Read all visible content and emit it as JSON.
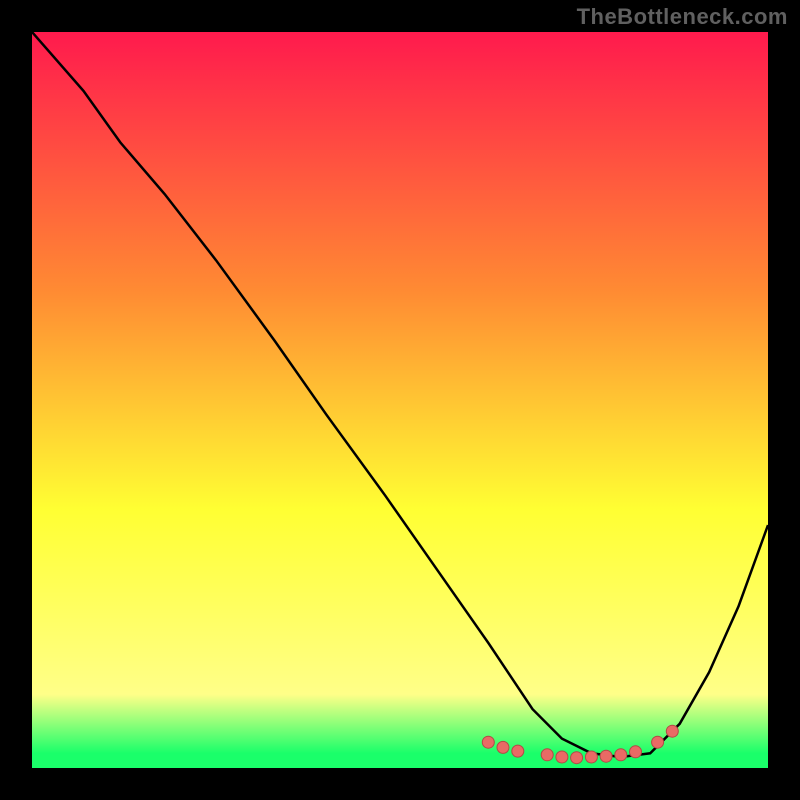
{
  "attribution": "TheBottleneck.com",
  "colors": {
    "gradient_top": "#ff1a4d",
    "gradient_mid_upper": "#ff8a33",
    "gradient_mid": "#ffff33",
    "gradient_lower": "#ffff88",
    "gradient_green": "#1aff6a",
    "curve": "#000000",
    "marker_fill": "#e96a65",
    "marker_stroke": "#b24a45",
    "frame": "#000000"
  },
  "chart_data": {
    "type": "line",
    "title": "",
    "xlabel": "",
    "ylabel": "",
    "xlim": [
      0,
      100
    ],
    "ylim": [
      0,
      100
    ],
    "curve": {
      "x": [
        0,
        7,
        12,
        18,
        25,
        33,
        40,
        48,
        55,
        62,
        68,
        72,
        76,
        80,
        84,
        88,
        92,
        96,
        100
      ],
      "y": [
        100,
        92,
        85,
        78,
        69,
        58,
        48,
        37,
        27,
        17,
        8,
        4,
        2,
        1.5,
        2,
        6,
        13,
        22,
        33
      ]
    },
    "markers": {
      "x": [
        62,
        64,
        66,
        70,
        72,
        74,
        76,
        78,
        80,
        82,
        85,
        87
      ],
      "y": [
        3.5,
        2.8,
        2.3,
        1.8,
        1.5,
        1.4,
        1.5,
        1.6,
        1.8,
        2.2,
        3.5,
        5.0
      ]
    },
    "annotations": []
  }
}
